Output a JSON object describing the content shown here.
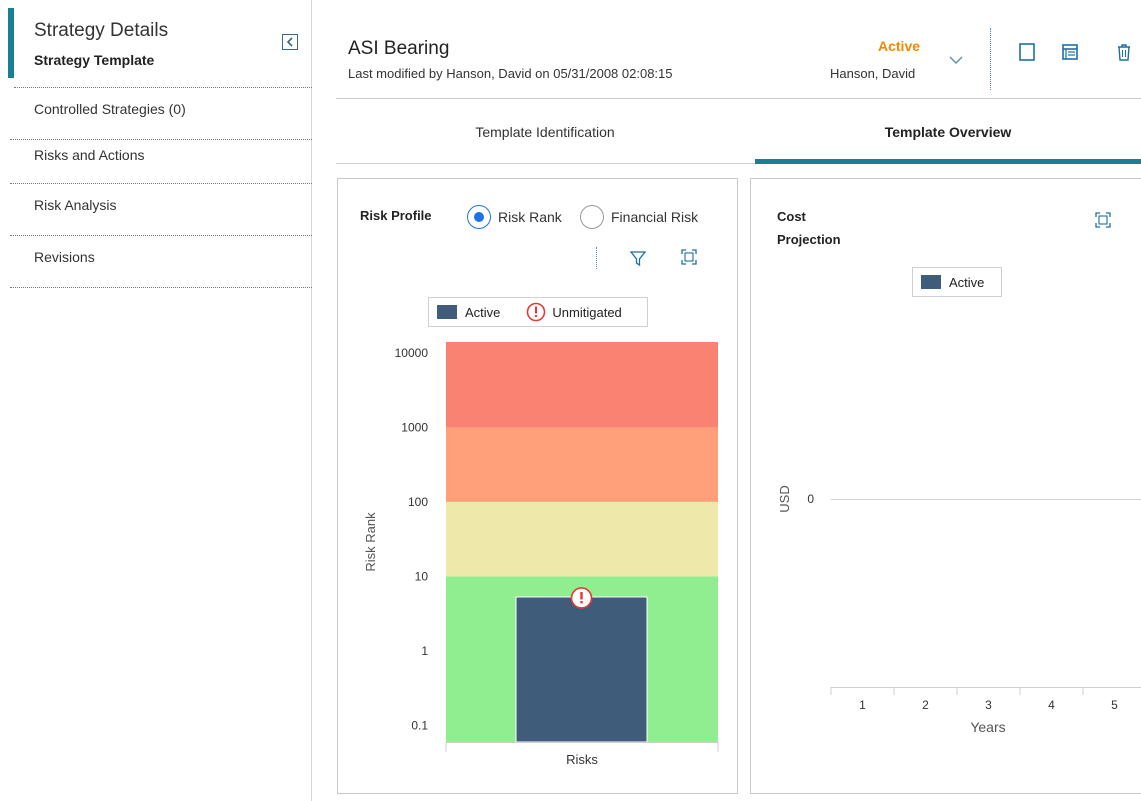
{
  "sidebar": {
    "title": "Strategy Details",
    "subtitle": "Strategy Template",
    "items": [
      {
        "label": "Controlled Strategies (0)"
      },
      {
        "label": "Risks and Actions"
      },
      {
        "label": "Risk Analysis"
      },
      {
        "label": "Revisions"
      }
    ]
  },
  "header": {
    "title": "ASI Bearing",
    "last_modified": "Last modified by Hanson, David on 05/31/2008 02:08:15",
    "status": "Active",
    "user": "Hanson, David"
  },
  "tabs": [
    {
      "label": "Template Identification",
      "active": false
    },
    {
      "label": "Template Overview",
      "active": true
    }
  ],
  "risk_profile": {
    "title": "Risk Profile",
    "radio_options": [
      {
        "label": "Risk Rank",
        "selected": true
      },
      {
        "label": "Financial Risk",
        "selected": false
      }
    ],
    "legend": {
      "active": "Active",
      "unmitigated": "Unmitigated"
    }
  },
  "cost_projection": {
    "title_line1": "Cost",
    "title_line2": "Projection",
    "legend": {
      "active": "Active"
    }
  },
  "colors": {
    "accent": "#1b7f93",
    "status_active": "#f08a00",
    "bar": "#3f5c7a",
    "band_red": "#f98272",
    "band_orange": "#ffa07a",
    "band_yellow": "#eee8aa",
    "band_green": "#90ee90",
    "unmitigated": "#e53935"
  },
  "chart_data": [
    {
      "type": "bar",
      "scale": "log",
      "categories": [
        "Risks"
      ],
      "series": [
        {
          "name": "Active",
          "values": [
            5.3
          ]
        }
      ],
      "unmitigated_marker": true,
      "bands": [
        {
          "from": 0.06,
          "to": 10,
          "color": "#90ee90"
        },
        {
          "from": 10,
          "to": 100,
          "color": "#eee8aa"
        },
        {
          "from": 100,
          "to": 1000,
          "color": "#ffa07a"
        },
        {
          "from": 1000,
          "to": 14000,
          "color": "#f98272"
        }
      ],
      "ticks": [
        "10000",
        "1000",
        "100",
        "10",
        "1",
        "0.1"
      ],
      "xlabel": "Risks",
      "ylabel": "Risk Rank",
      "legend": "top"
    },
    {
      "type": "line",
      "categories": [
        "1",
        "2",
        "3",
        "4",
        "5"
      ],
      "series": [
        {
          "name": "Active",
          "values": []
        }
      ],
      "yticks": [
        "0"
      ],
      "xlabel": "Years",
      "ylabel": "USD",
      "legend": "top"
    }
  ]
}
